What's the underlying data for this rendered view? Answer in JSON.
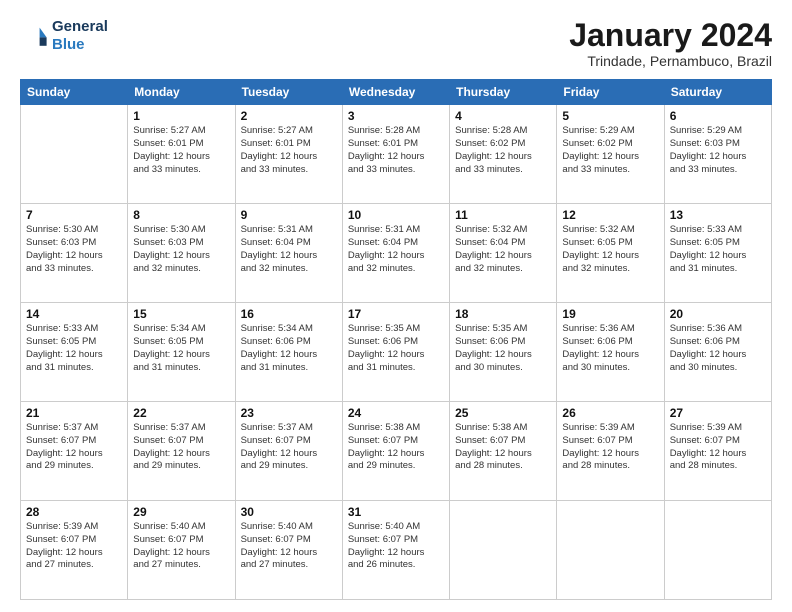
{
  "logo": {
    "line1": "General",
    "line2": "Blue"
  },
  "header": {
    "title": "January 2024",
    "subtitle": "Trindade, Pernambuco, Brazil"
  },
  "weekdays": [
    "Sunday",
    "Monday",
    "Tuesday",
    "Wednesday",
    "Thursday",
    "Friday",
    "Saturday"
  ],
  "weeks": [
    [
      {
        "day": "",
        "text": ""
      },
      {
        "day": "1",
        "text": "Sunrise: 5:27 AM\nSunset: 6:01 PM\nDaylight: 12 hours\nand 33 minutes."
      },
      {
        "day": "2",
        "text": "Sunrise: 5:27 AM\nSunset: 6:01 PM\nDaylight: 12 hours\nand 33 minutes."
      },
      {
        "day": "3",
        "text": "Sunrise: 5:28 AM\nSunset: 6:01 PM\nDaylight: 12 hours\nand 33 minutes."
      },
      {
        "day": "4",
        "text": "Sunrise: 5:28 AM\nSunset: 6:02 PM\nDaylight: 12 hours\nand 33 minutes."
      },
      {
        "day": "5",
        "text": "Sunrise: 5:29 AM\nSunset: 6:02 PM\nDaylight: 12 hours\nand 33 minutes."
      },
      {
        "day": "6",
        "text": "Sunrise: 5:29 AM\nSunset: 6:03 PM\nDaylight: 12 hours\nand 33 minutes."
      }
    ],
    [
      {
        "day": "7",
        "text": "Sunrise: 5:30 AM\nSunset: 6:03 PM\nDaylight: 12 hours\nand 33 minutes."
      },
      {
        "day": "8",
        "text": "Sunrise: 5:30 AM\nSunset: 6:03 PM\nDaylight: 12 hours\nand 32 minutes."
      },
      {
        "day": "9",
        "text": "Sunrise: 5:31 AM\nSunset: 6:04 PM\nDaylight: 12 hours\nand 32 minutes."
      },
      {
        "day": "10",
        "text": "Sunrise: 5:31 AM\nSunset: 6:04 PM\nDaylight: 12 hours\nand 32 minutes."
      },
      {
        "day": "11",
        "text": "Sunrise: 5:32 AM\nSunset: 6:04 PM\nDaylight: 12 hours\nand 32 minutes."
      },
      {
        "day": "12",
        "text": "Sunrise: 5:32 AM\nSunset: 6:05 PM\nDaylight: 12 hours\nand 32 minutes."
      },
      {
        "day": "13",
        "text": "Sunrise: 5:33 AM\nSunset: 6:05 PM\nDaylight: 12 hours\nand 31 minutes."
      }
    ],
    [
      {
        "day": "14",
        "text": "Sunrise: 5:33 AM\nSunset: 6:05 PM\nDaylight: 12 hours\nand 31 minutes."
      },
      {
        "day": "15",
        "text": "Sunrise: 5:34 AM\nSunset: 6:05 PM\nDaylight: 12 hours\nand 31 minutes."
      },
      {
        "day": "16",
        "text": "Sunrise: 5:34 AM\nSunset: 6:06 PM\nDaylight: 12 hours\nand 31 minutes."
      },
      {
        "day": "17",
        "text": "Sunrise: 5:35 AM\nSunset: 6:06 PM\nDaylight: 12 hours\nand 31 minutes."
      },
      {
        "day": "18",
        "text": "Sunrise: 5:35 AM\nSunset: 6:06 PM\nDaylight: 12 hours\nand 30 minutes."
      },
      {
        "day": "19",
        "text": "Sunrise: 5:36 AM\nSunset: 6:06 PM\nDaylight: 12 hours\nand 30 minutes."
      },
      {
        "day": "20",
        "text": "Sunrise: 5:36 AM\nSunset: 6:06 PM\nDaylight: 12 hours\nand 30 minutes."
      }
    ],
    [
      {
        "day": "21",
        "text": "Sunrise: 5:37 AM\nSunset: 6:07 PM\nDaylight: 12 hours\nand 29 minutes."
      },
      {
        "day": "22",
        "text": "Sunrise: 5:37 AM\nSunset: 6:07 PM\nDaylight: 12 hours\nand 29 minutes."
      },
      {
        "day": "23",
        "text": "Sunrise: 5:37 AM\nSunset: 6:07 PM\nDaylight: 12 hours\nand 29 minutes."
      },
      {
        "day": "24",
        "text": "Sunrise: 5:38 AM\nSunset: 6:07 PM\nDaylight: 12 hours\nand 29 minutes."
      },
      {
        "day": "25",
        "text": "Sunrise: 5:38 AM\nSunset: 6:07 PM\nDaylight: 12 hours\nand 28 minutes."
      },
      {
        "day": "26",
        "text": "Sunrise: 5:39 AM\nSunset: 6:07 PM\nDaylight: 12 hours\nand 28 minutes."
      },
      {
        "day": "27",
        "text": "Sunrise: 5:39 AM\nSunset: 6:07 PM\nDaylight: 12 hours\nand 28 minutes."
      }
    ],
    [
      {
        "day": "28",
        "text": "Sunrise: 5:39 AM\nSunset: 6:07 PM\nDaylight: 12 hours\nand 27 minutes."
      },
      {
        "day": "29",
        "text": "Sunrise: 5:40 AM\nSunset: 6:07 PM\nDaylight: 12 hours\nand 27 minutes."
      },
      {
        "day": "30",
        "text": "Sunrise: 5:40 AM\nSunset: 6:07 PM\nDaylight: 12 hours\nand 27 minutes."
      },
      {
        "day": "31",
        "text": "Sunrise: 5:40 AM\nSunset: 6:07 PM\nDaylight: 12 hours\nand 26 minutes."
      },
      {
        "day": "",
        "text": ""
      },
      {
        "day": "",
        "text": ""
      },
      {
        "day": "",
        "text": ""
      }
    ]
  ]
}
